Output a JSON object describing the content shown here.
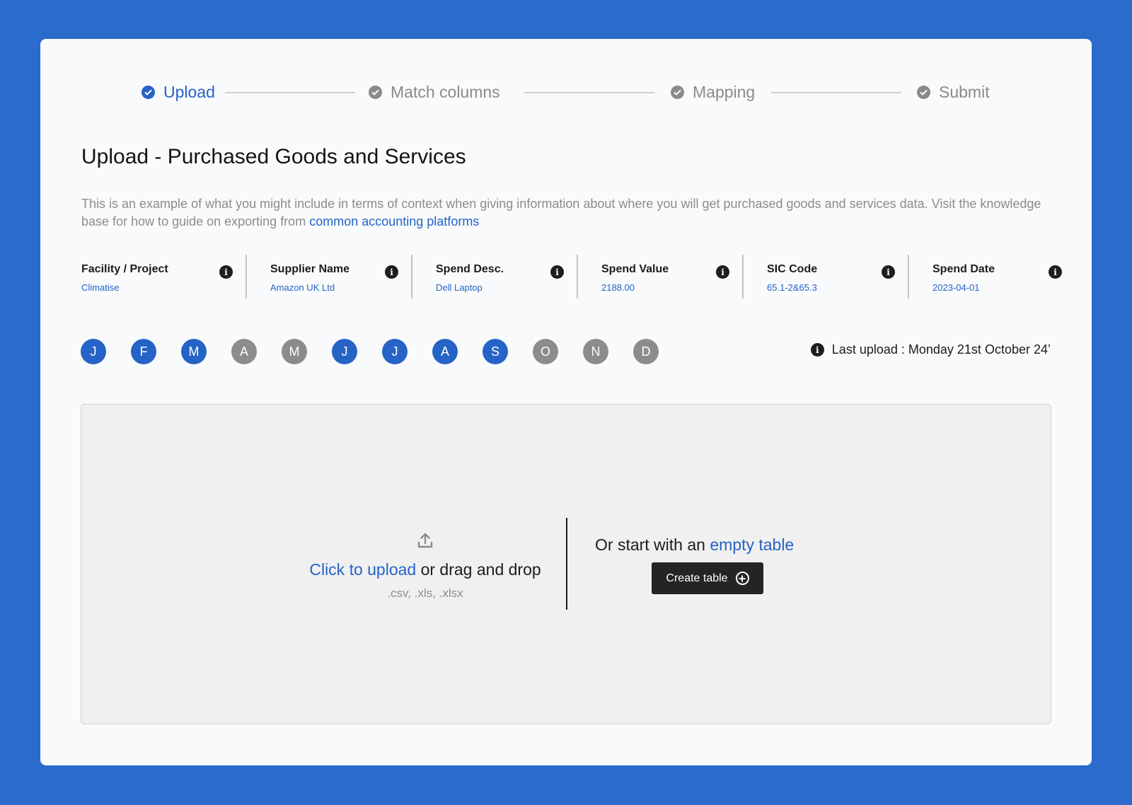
{
  "stepper": {
    "steps": [
      {
        "label": "Upload",
        "state": "active"
      },
      {
        "label": "Match columns",
        "state": "inactive"
      },
      {
        "label": "Mapping",
        "state": "inactive"
      },
      {
        "label": "Submit",
        "state": "inactive"
      }
    ]
  },
  "page": {
    "title": "Upload - Purchased Goods and Services",
    "description": "This is an example of what you might include in terms of context when giving information about where you will get purchased goods and services data. Visit the knowledge base for how to guide on exporting from ",
    "description_link": "common accounting platforms"
  },
  "fields": [
    {
      "name": "Facility / Project",
      "value": "Climatise"
    },
    {
      "name": "Supplier Name",
      "value": "Amazon UK Ltd"
    },
    {
      "name": "Spend Desc.",
      "value": "Dell Laptop"
    },
    {
      "name": "Spend Value",
      "value": "2188.00"
    },
    {
      "name": "SIC Code",
      "value": "65.1-2&65.3"
    },
    {
      "name": "Spend Date",
      "value": "2023-04-01"
    }
  ],
  "months": [
    {
      "letter": "J",
      "uploaded": true
    },
    {
      "letter": "F",
      "uploaded": true
    },
    {
      "letter": "M",
      "uploaded": true
    },
    {
      "letter": "A",
      "uploaded": false
    },
    {
      "letter": "M",
      "uploaded": false
    },
    {
      "letter": "J",
      "uploaded": true
    },
    {
      "letter": "J",
      "uploaded": true
    },
    {
      "letter": "A",
      "uploaded": true
    },
    {
      "letter": "S",
      "uploaded": true
    },
    {
      "letter": "O",
      "uploaded": false
    },
    {
      "letter": "N",
      "uploaded": false
    },
    {
      "letter": "D",
      "uploaded": false
    }
  ],
  "last_upload": "Last upload : Monday 21st October 24’",
  "dropzone": {
    "upload_link": "Click to upload",
    "upload_rest": " or drag and drop",
    "file_types": ".csv, .xls, .xlsx",
    "empty_prefix": "Or start with an ",
    "empty_link": "empty table",
    "create_button": "Create table"
  },
  "icons": {
    "step_check": "check-circle-icon",
    "info": "info-icon",
    "upload": "upload-icon",
    "plus": "plus-circle-icon"
  },
  "colors": {
    "background": "#2B6BCC",
    "accent": "#2563C7",
    "inactive": "#8C8C8C",
    "button": "#242424"
  }
}
